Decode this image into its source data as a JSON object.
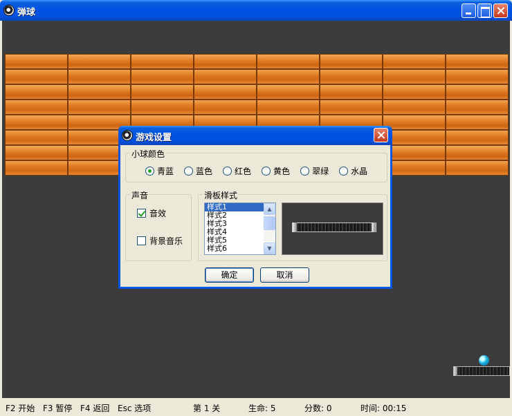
{
  "window": {
    "title": "弹球"
  },
  "status": {
    "f2": "F2 开始",
    "f3": "F3 暂停",
    "f4": "F4 返回",
    "esc": "Esc 选项",
    "level": "第 1 关",
    "lives": "生命: 5",
    "score": "分数: 0",
    "time": "时间: 00:15"
  },
  "dialog": {
    "title": "游戏设置",
    "ball_color": {
      "label": "小球颜色",
      "options": [
        "青蓝",
        "蓝色",
        "红色",
        "黄色",
        "翠绿",
        "水晶"
      ],
      "selected": "青蓝"
    },
    "sound": {
      "label": "声音",
      "sfx_label": "音效",
      "sfx_checked": true,
      "bgm_label": "背景音乐",
      "bgm_checked": false
    },
    "paddle_style": {
      "label": "滑板样式",
      "items": [
        "样式1",
        "样式2",
        "样式3",
        "样式4",
        "样式5",
        "样式6"
      ],
      "selected": "样式1"
    },
    "ok_label": "确定",
    "cancel_label": "取消"
  },
  "colors": {
    "titlebar": "#0053e3",
    "playfield": "#3c3c3c",
    "brick": "#e07a22",
    "ball": "#1ab2e6"
  },
  "icons": [
    "app-icon",
    "minimize-icon",
    "maximize-icon",
    "close-icon",
    "scroll-up-icon",
    "scroll-down-icon"
  ]
}
